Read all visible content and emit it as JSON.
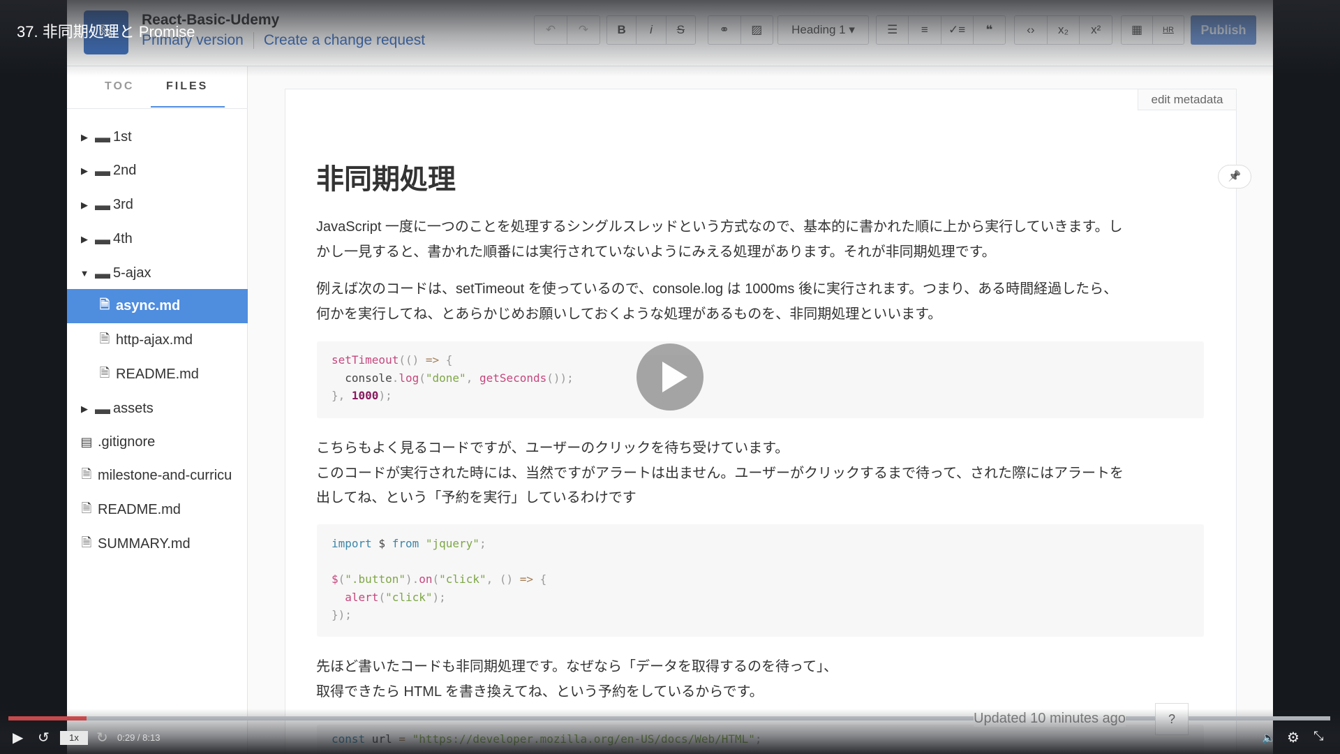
{
  "video": {
    "title": "37. 非同期処理と Promise",
    "current_time": "0:29",
    "duration": "8:13",
    "time_display": "0:29 / 8:13",
    "progress_fraction": 0.059,
    "speed": "1x",
    "accent": "#ee5253"
  },
  "header": {
    "repo_title": "React-Basic-Udemy",
    "primary_version": "Primary version",
    "change_request": "Create a change request",
    "publish": "Publish",
    "heading_select": "Heading 1 ▾",
    "toolbar": {
      "undo": "↶",
      "redo": "↷",
      "bold": "B",
      "italic": "i",
      "strike": "S",
      "link": "⚭",
      "image": "▨",
      "bullet": "☰",
      "numbered": "≡",
      "task": "✓≡",
      "quote": "❝",
      "code": "‹›",
      "sub": "x₂",
      "sup": "x²",
      "table": "▦",
      "hr": "HR"
    }
  },
  "sidebar": {
    "tabs": [
      "TOC",
      "FILES"
    ],
    "active_tab": "FILES",
    "items": [
      {
        "label": "1st",
        "type": "folder",
        "depth": 0,
        "expanded": false
      },
      {
        "label": "2nd",
        "type": "folder",
        "depth": 0,
        "expanded": false
      },
      {
        "label": "3rd",
        "type": "folder",
        "depth": 0,
        "expanded": false
      },
      {
        "label": "4th",
        "type": "folder",
        "depth": 0,
        "expanded": false
      },
      {
        "label": "5-ajax",
        "type": "folder",
        "depth": 0,
        "expanded": true
      },
      {
        "label": "async.md",
        "type": "file",
        "depth": 1,
        "selected": true
      },
      {
        "label": "http-ajax.md",
        "type": "file",
        "depth": 1
      },
      {
        "label": "README.md",
        "type": "file",
        "depth": 1
      },
      {
        "label": "assets",
        "type": "folder",
        "depth": 0,
        "expanded": false
      },
      {
        "label": ".gitignore",
        "type": "binary",
        "depth": -1
      },
      {
        "label": "milestone-and-curricu",
        "type": "file",
        "depth": -1
      },
      {
        "label": "README.md",
        "type": "file",
        "depth": -1
      },
      {
        "label": "SUMMARY.md",
        "type": "file",
        "depth": -1
      }
    ]
  },
  "main": {
    "edit_metadata": "edit metadata",
    "title": "非同期処理",
    "p1": [
      "JavaScript 一度に一つのことを処理するシングルスレッドという方式なので、基本的に書かれた順に上から実行していきます。し",
      "かし一見すると、書かれた順番には実行されていないようにみえる処理があります。それが非同期処理です。"
    ],
    "p2": [
      "例えば次のコードは、setTimeout を使っているので、console.log は 1000ms 後に実行されます。つまり、ある時間経過したら、",
      "何かを実行してね、とあらかじめお願いしておくような処理があるものを、非同期処理といいます。"
    ],
    "p3": [
      "こちらもよく見るコードですが、ユーザーのクリックを待ち受けています。",
      "このコードが実行された時には、当然ですがアラートは出ません。ユーザーがクリックするまで待って、された際にはアラートを",
      "出してね、という「予約を実行」しているわけです"
    ],
    "p4": [
      "先ほど書いたコードも非同期処理です。なぜなら「データを取得するのを待って」、",
      "取得できたら HTML を書き換えてね、という予約をしているからです。"
    ],
    "code1": [
      [
        [
          "setTimeout",
          "k"
        ],
        [
          "(() ",
          "pu"
        ],
        [
          "=>",
          "o"
        ],
        [
          " {",
          "pu"
        ]
      ],
      [
        [
          "  console",
          "t"
        ],
        [
          ".",
          "pu"
        ],
        [
          "log",
          "k"
        ],
        [
          "(",
          "pu"
        ],
        [
          "\"done\"",
          "s"
        ],
        [
          ", ",
          "pu"
        ],
        [
          "getSeconds",
          "k"
        ],
        [
          "());",
          "pu"
        ]
      ],
      [
        [
          "}, ",
          "pu"
        ],
        [
          "1000",
          "n"
        ],
        [
          ");",
          "pu"
        ]
      ]
    ],
    "code2": [
      [
        [
          "import",
          "b"
        ],
        [
          " $ ",
          "t"
        ],
        [
          "from",
          "b"
        ],
        [
          " ",
          "t"
        ],
        [
          "\"jquery\"",
          "s"
        ],
        [
          ";",
          "pu"
        ]
      ],
      [],
      [
        [
          "$",
          "k"
        ],
        [
          "(",
          "pu"
        ],
        [
          "\".button\"",
          "s"
        ],
        [
          ").",
          "pu"
        ],
        [
          "on",
          "k"
        ],
        [
          "(",
          "pu"
        ],
        [
          "\"click\"",
          "s"
        ],
        [
          ", () ",
          "pu"
        ],
        [
          "=>",
          "o"
        ],
        [
          " {",
          "pu"
        ]
      ],
      [
        [
          "  alert",
          "k"
        ],
        [
          "(",
          "pu"
        ],
        [
          "\"click\"",
          "s"
        ],
        [
          ");",
          "pu"
        ]
      ],
      [
        [
          "});",
          "pu"
        ]
      ]
    ],
    "code3": [
      [
        [
          "const",
          "b"
        ],
        [
          " url ",
          "t"
        ],
        [
          "=",
          "o"
        ],
        [
          " ",
          "t"
        ],
        [
          "\"https://developer.mozilla.org/en-US/docs/Web/HTML\"",
          "s"
        ],
        [
          ";",
          "pu"
        ]
      ]
    ],
    "updated": "Updated 10 minutes ago",
    "help": "?",
    "pin_icon": "📌"
  }
}
